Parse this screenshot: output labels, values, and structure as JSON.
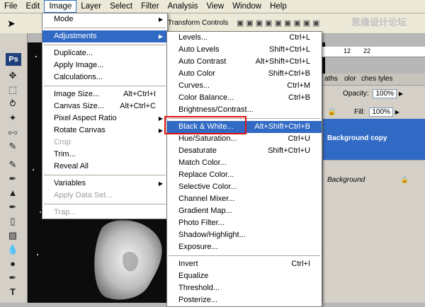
{
  "menubar": {
    "items": [
      "File",
      "Edit",
      "Image",
      "Layer",
      "Select",
      "Filter",
      "Analysis",
      "View",
      "Window",
      "Help"
    ],
    "active": "Image"
  },
  "options_bar": {
    "transform_controls": "Transform Controls"
  },
  "watermark": "思缘设计论坛",
  "toolbox": {
    "ps_badge": "Ps"
  },
  "ruler": {
    "ticks": [
      "12",
      "22"
    ]
  },
  "image_menu": {
    "items": [
      {
        "label": "Mode",
        "shortcut": "",
        "submenu": true
      },
      {
        "sep": true
      },
      {
        "label": "Adjustments",
        "shortcut": "",
        "submenu": true,
        "highlighted": true
      },
      {
        "sep": true
      },
      {
        "label": "Duplicate...",
        "shortcut": ""
      },
      {
        "label": "Apply Image...",
        "shortcut": ""
      },
      {
        "label": "Calculations...",
        "shortcut": ""
      },
      {
        "sep": true
      },
      {
        "label": "Image Size...",
        "shortcut": "Alt+Ctrl+I"
      },
      {
        "label": "Canvas Size...",
        "shortcut": "Alt+Ctrl+C"
      },
      {
        "label": "Pixel Aspect Ratio",
        "shortcut": "",
        "submenu": true
      },
      {
        "label": "Rotate Canvas",
        "shortcut": "",
        "submenu": true
      },
      {
        "label": "Crop",
        "shortcut": "",
        "disabled": true
      },
      {
        "label": "Trim...",
        "shortcut": ""
      },
      {
        "label": "Reveal All",
        "shortcut": ""
      },
      {
        "sep": true
      },
      {
        "label": "Variables",
        "shortcut": "",
        "submenu": true
      },
      {
        "label": "Apply Data Set...",
        "shortcut": "",
        "disabled": true
      },
      {
        "sep": true
      },
      {
        "label": "Trap...",
        "shortcut": "",
        "disabled": true
      }
    ]
  },
  "adjustments_menu": {
    "items": [
      {
        "label": "Levels...",
        "shortcut": "Ctrl+L"
      },
      {
        "label": "Auto Levels",
        "shortcut": "Shift+Ctrl+L"
      },
      {
        "label": "Auto Contrast",
        "shortcut": "Alt+Shift+Ctrl+L"
      },
      {
        "label": "Auto Color",
        "shortcut": "Shift+Ctrl+B"
      },
      {
        "label": "Curves...",
        "shortcut": "Ctrl+M"
      },
      {
        "label": "Color Balance...",
        "shortcut": "Ctrl+B"
      },
      {
        "label": "Brightness/Contrast...",
        "shortcut": ""
      },
      {
        "sep": true
      },
      {
        "label": "Black & White...",
        "shortcut": "Alt+Shift+Ctrl+B",
        "highlighted": true
      },
      {
        "label": "Hue/Saturation...",
        "shortcut": "Ctrl+U"
      },
      {
        "label": "Desaturate",
        "shortcut": "Shift+Ctrl+U"
      },
      {
        "label": "Match Color...",
        "shortcut": ""
      },
      {
        "label": "Replace Color...",
        "shortcut": ""
      },
      {
        "label": "Selective Color...",
        "shortcut": ""
      },
      {
        "label": "Channel Mixer...",
        "shortcut": ""
      },
      {
        "label": "Gradient Map...",
        "shortcut": ""
      },
      {
        "label": "Photo Filter...",
        "shortcut": ""
      },
      {
        "label": "Shadow/Highlight...",
        "shortcut": ""
      },
      {
        "label": "Exposure...",
        "shortcut": ""
      },
      {
        "sep": true
      },
      {
        "label": "Invert",
        "shortcut": "Ctrl+I"
      },
      {
        "label": "Equalize",
        "shortcut": ""
      },
      {
        "label": "Threshold...",
        "shortcut": ""
      },
      {
        "label": "Posterize...",
        "shortcut": ""
      }
    ]
  },
  "layers_panel": {
    "tabs": [
      "aths",
      "olor",
      "ches",
      "tyles"
    ],
    "opacity_label": "Opacity:",
    "opacity_value": "100%",
    "fill_label": "Fill:",
    "fill_value": "100%",
    "layers": [
      {
        "name": "Background copy",
        "selected": true
      },
      {
        "name": "Background",
        "selected": false,
        "locked": true
      }
    ]
  },
  "colors": {
    "highlight": "#316ac5",
    "callout": "#e01010"
  }
}
